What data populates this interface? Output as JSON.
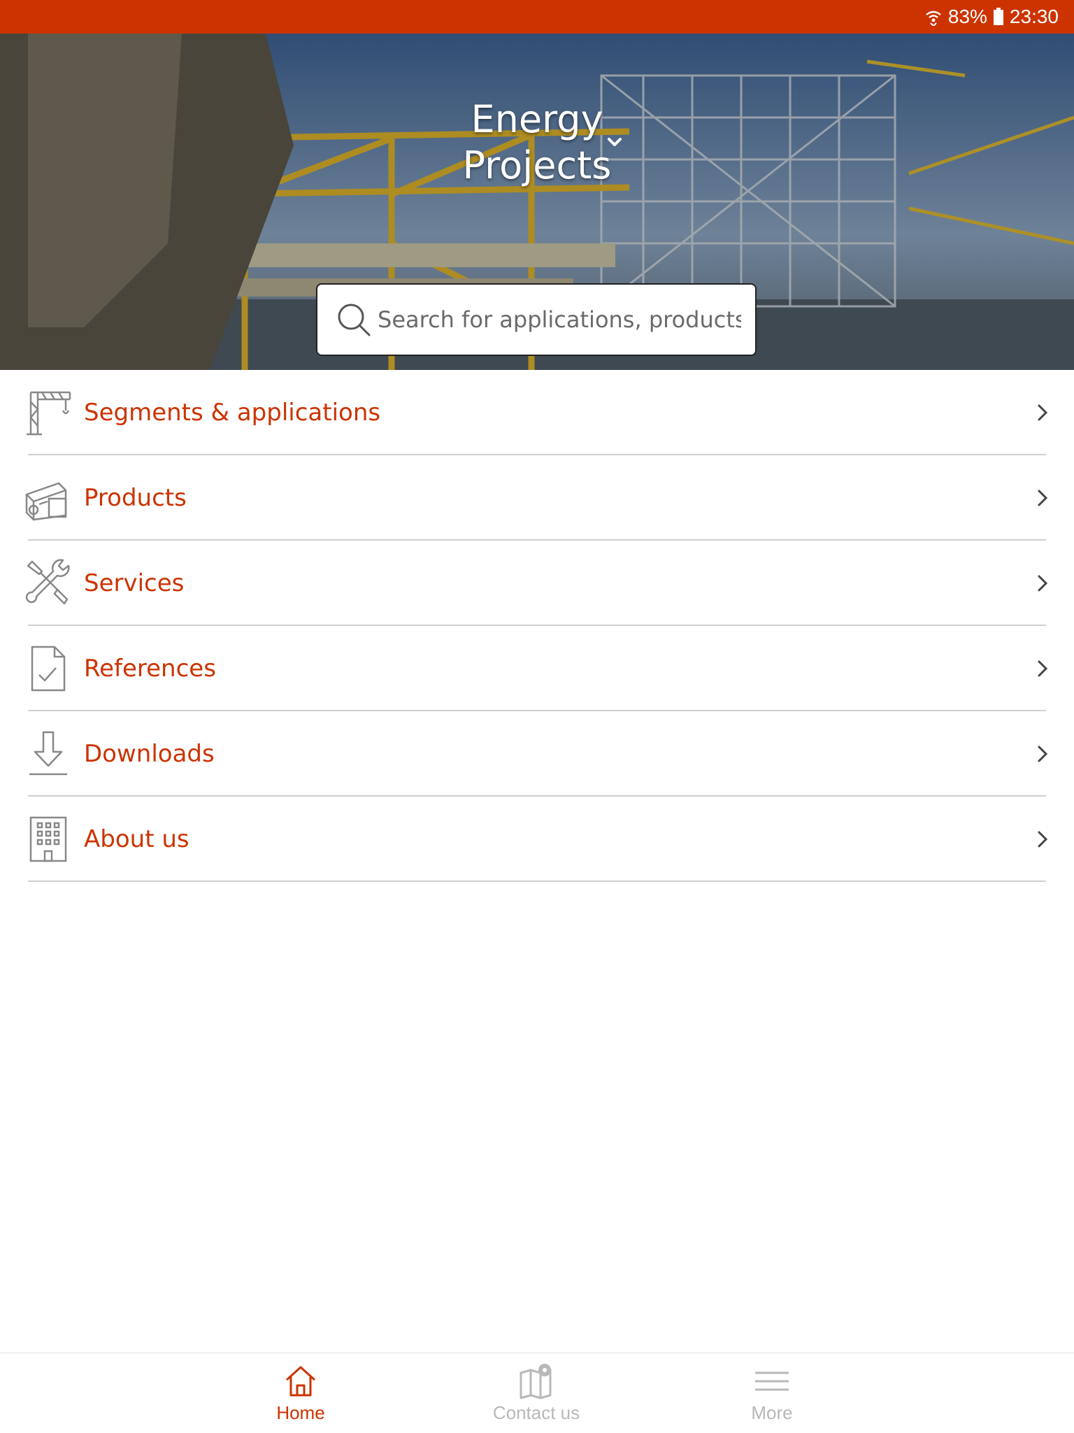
{
  "status_bar": {
    "battery": "83%",
    "time": "23:30"
  },
  "colors": {
    "accent": "#cc3300",
    "status_bar": "#cc3300",
    "inactive_tab": "#b8b8b8",
    "divider": "#cfcfcf"
  },
  "hero": {
    "title_line1": "Energy",
    "title_line2": "Projects",
    "selector_icon": "chevron-down-icon"
  },
  "search": {
    "placeholder": "Search for applications, products....",
    "icon": "search-icon"
  },
  "menu": {
    "items": [
      {
        "label": "Segments & applications",
        "icon": "crane-icon"
      },
      {
        "label": "Products",
        "icon": "products-icon"
      },
      {
        "label": "Services",
        "icon": "tools-icon"
      },
      {
        "label": "References",
        "icon": "document-check-icon"
      },
      {
        "label": "Downloads",
        "icon": "download-icon"
      },
      {
        "label": "About us",
        "icon": "building-icon"
      }
    ]
  },
  "tabbar": {
    "tabs": [
      {
        "label": "Home",
        "icon": "home-icon",
        "active": true
      },
      {
        "label": "Contact us",
        "icon": "map-pin-icon",
        "active": false
      },
      {
        "label": "More",
        "icon": "menu-icon",
        "active": false
      }
    ]
  }
}
